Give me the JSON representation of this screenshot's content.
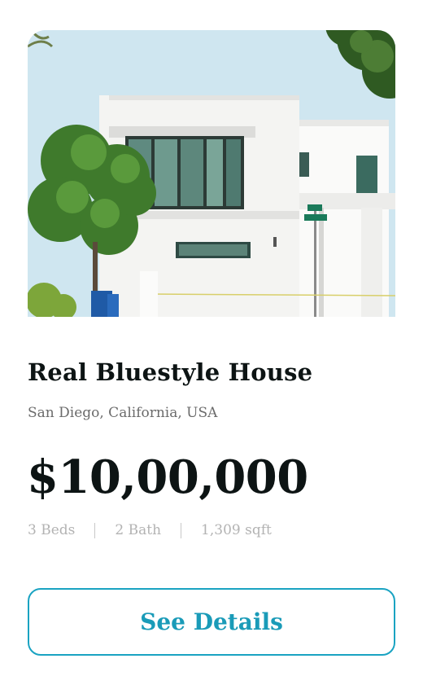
{
  "listing": {
    "photo_subject": "modern-white-house-photo",
    "title": "Real Bluestyle House",
    "location": "San Diego, California, USA",
    "price": "$10,00,000",
    "specs": {
      "beds": "3 Beds",
      "bath": "2 Bath",
      "area": "1,309 sqft"
    },
    "details_button_label": "See Details"
  },
  "colors": {
    "accent": "#1aa3c2",
    "heading": "#0d1414",
    "muted": "#6b6b6b",
    "spec_text": "#b3b3b3"
  }
}
